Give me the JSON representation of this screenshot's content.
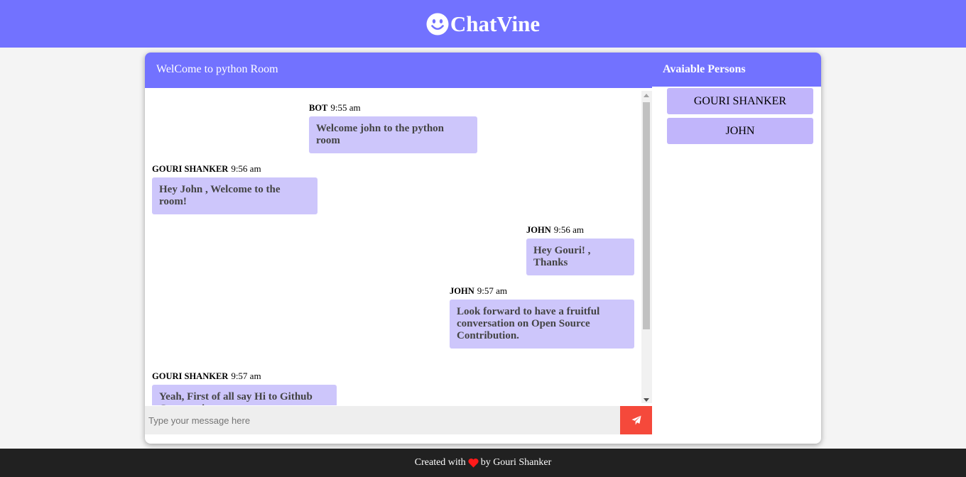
{
  "app": {
    "brand": "ChatVine",
    "brand_icon": "smiley-icon",
    "accent": "#7272ff"
  },
  "chat": {
    "header": "WelCome to python Room",
    "messages": [
      {
        "author": "BOT",
        "time": "9:55 am",
        "text": "Welcome john to the python room"
      },
      {
        "author": "GOURI SHANKER",
        "time": "9:56 am",
        "text": "Hey John , Welcome to the room!"
      },
      {
        "author": "JOHN",
        "time": "9:56 am",
        "text": "Hey Gouri! , Thanks"
      },
      {
        "author": "JOHN",
        "time": "9:57 am",
        "text": "Look forward to have a fruitful conversation on Open Source Contribution."
      },
      {
        "author": "GOURI SHANKER",
        "time": "9:57 am",
        "text": "Yeah, First of all say Hi to Github Community"
      }
    ],
    "input_placeholder": "Type your message here",
    "send_icon": "paper-plane-icon",
    "send_color": "#f5493b"
  },
  "sidebar": {
    "title": "Avaiable Persons",
    "persons": [
      "GOURI SHANKER",
      "JOHN"
    ]
  },
  "footer": {
    "prefix": "Created with",
    "heart_icon": "heart-icon",
    "suffix": "by Gouri Shanker"
  }
}
